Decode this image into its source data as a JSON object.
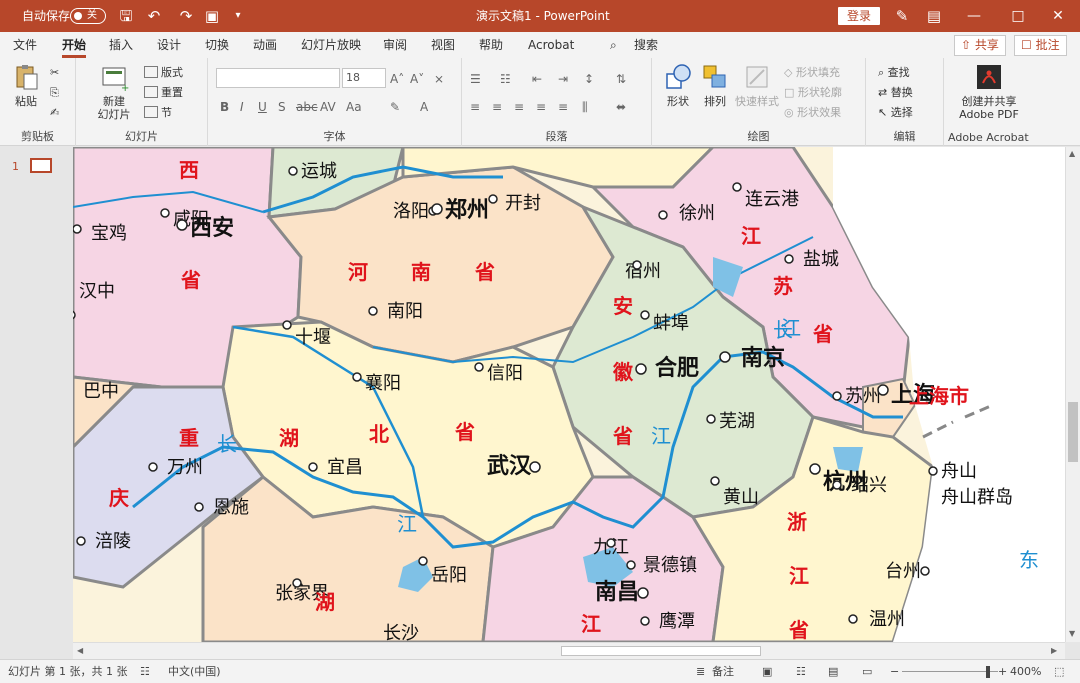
{
  "titlebar": {
    "autosave_label": "自动保存",
    "autosave_state": "关",
    "doc_title": "演示文稿1 - PowerPoint",
    "search": "搜索",
    "login": "登录"
  },
  "tabs": [
    {
      "label": "文件"
    },
    {
      "label": "开始",
      "active": true
    },
    {
      "label": "插入"
    },
    {
      "label": "设计"
    },
    {
      "label": "切换"
    },
    {
      "label": "动画"
    },
    {
      "label": "幻灯片放映"
    },
    {
      "label": "审阅"
    },
    {
      "label": "视图"
    },
    {
      "label": "帮助"
    },
    {
      "label": "Acrobat"
    }
  ],
  "share": {
    "share": "共享",
    "comment": "批注"
  },
  "ribbon": {
    "clipboard": {
      "paste": "粘贴",
      "group": "剪贴板"
    },
    "slides": {
      "new_slide_1": "新建",
      "new_slide_2": "幻灯片",
      "layout": "版式",
      "reset": "重置",
      "section": "节",
      "group": "幻灯片"
    },
    "font": {
      "size": "18",
      "group": "字体"
    },
    "paragraph": {
      "group": "段落"
    },
    "drawing": {
      "shapes": "形状",
      "arrange": "排列",
      "quick_styles": "快速样式",
      "fill": "形状填充",
      "outline": "形状轮廓",
      "effects": "形状效果",
      "group": "绘图"
    },
    "editing": {
      "find": "查找",
      "replace": "替换",
      "select": "选择",
      "group": "编辑"
    },
    "acrobat": {
      "create_1": "创建并共享",
      "create_2": "Adobe PDF",
      "group": "Adobe Acrobat"
    }
  },
  "slides_panel": {
    "number": "1"
  },
  "map": {
    "cities": [
      {
        "name": "运城"
      },
      {
        "name": "洛阳"
      },
      {
        "name": "郑州"
      },
      {
        "name": "开封"
      },
      {
        "name": "徐州"
      },
      {
        "name": "连云港"
      },
      {
        "name": "咸阳"
      },
      {
        "name": "西安"
      },
      {
        "name": "宝鸡"
      },
      {
        "name": "汉中"
      },
      {
        "name": "南阳"
      },
      {
        "name": "宿州"
      },
      {
        "name": "盐城"
      },
      {
        "name": "蚌埠"
      },
      {
        "name": "十堰"
      },
      {
        "name": "襄阳"
      },
      {
        "name": "信阳"
      },
      {
        "name": "合肥"
      },
      {
        "name": "南京"
      },
      {
        "name": "苏州"
      },
      {
        "name": "上海"
      },
      {
        "name": "巴中"
      },
      {
        "name": "万州"
      },
      {
        "name": "宜昌"
      },
      {
        "name": "武汉"
      },
      {
        "name": "芜湖"
      },
      {
        "name": "恩施"
      },
      {
        "name": "黄山"
      },
      {
        "name": "杭州"
      },
      {
        "name": "绍兴"
      },
      {
        "name": "舟山"
      },
      {
        "name": "舟山群岛"
      },
      {
        "name": "涪陵"
      },
      {
        "name": "九江"
      },
      {
        "name": "景德镇"
      },
      {
        "name": "岳阳"
      },
      {
        "name": "张家界"
      },
      {
        "name": "南昌"
      },
      {
        "name": "台州"
      },
      {
        "name": "鹰潭"
      },
      {
        "name": "温州"
      },
      {
        "name": "长沙"
      }
    ],
    "province_chars": [
      "西",
      "省",
      "河",
      "南",
      "省",
      "安",
      "徽",
      "省",
      "江",
      "苏",
      "省",
      "上海市",
      "重",
      "湖",
      "北",
      "省",
      "庆",
      "浙",
      "江",
      "省",
      "湖",
      "江"
    ],
    "river_chars": [
      "长",
      "江",
      "长",
      "江",
      "江",
      "东"
    ]
  },
  "status": {
    "slide_info": "幻灯片 第 1 张，共 1 张",
    "language": "中文(中国)",
    "notes": "备注",
    "zoom": "400%"
  }
}
